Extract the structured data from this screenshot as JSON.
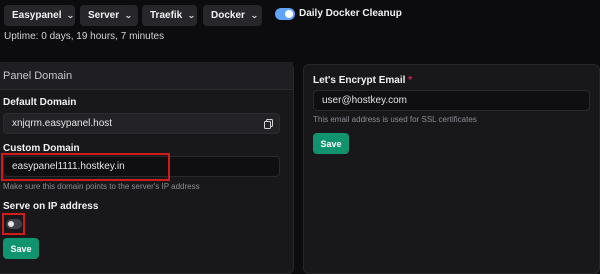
{
  "toolbar": {
    "menus": [
      {
        "label": "Easypanel"
      },
      {
        "label": "Server"
      },
      {
        "label": "Traefik"
      },
      {
        "label": "Docker"
      }
    ],
    "docker_cleanup": {
      "label": "Daily Docker Cleanup",
      "enabled": true
    }
  },
  "uptime": "Uptime: 0 days, 19 hours, 7 minutes",
  "panel_domain": {
    "title": "Panel Domain",
    "default_domain": {
      "label": "Default Domain",
      "value": "xnjqrm.easypanel.host"
    },
    "custom_domain": {
      "label": "Custom Domain",
      "value": "easypanel1111.hostkey.in",
      "hint": "Make sure this domain points to the server's IP address"
    },
    "serve_on_ip": {
      "label": "Serve on IP address",
      "enabled": false
    },
    "save_label": "Save"
  },
  "lets_encrypt": {
    "label": "Let's Encrypt Email",
    "required_mark": "*",
    "value": "user@hostkey.com",
    "hint": "This email address is used for SSL certificates",
    "save_label": "Save"
  },
  "colors": {
    "accent": "#60a5fa",
    "save": "#10936f",
    "highlight": "#d11a1a",
    "required": "#e11d48"
  }
}
